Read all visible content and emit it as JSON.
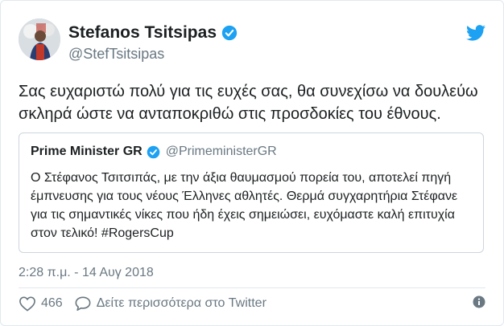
{
  "author": {
    "name": "Stefanos Tsitsipas",
    "handle": "@StefTsitsipas"
  },
  "tweet": {
    "text": "Σας ευχαριστώ πολύ για τις ευχές σας, θα συνεχίσω να δουλεύω σκληρά ώστε να ανταποκριθώ στις προσδοκίες του έθνους."
  },
  "quoted": {
    "name": "Prime Minister GR",
    "handle": "@PrimeministerGR",
    "text": "Ο Στέφανος Τσιτσιπάς, με την άξια θαυμασμού πορεία του, αποτελεί πηγή έμπνευσης για τους νέους Έλληνες αθλητές. Θερμά συγχαρητήρια Στέφανε για τις σημαντικές νίκες που ήδη έχεις σημειώσει, ευχόμαστε καλή επιτυχία στον τελικό! #RogersCup"
  },
  "timestamp": "2:28 π.μ. - 14 Αυγ 2018",
  "actions": {
    "like_count": "466",
    "more_label": "Δείτε περισσότερα στο Twitter"
  },
  "icons": {
    "avatar": "avatar",
    "verified": "verified-badge-icon",
    "logo": "twitter-bird-icon",
    "like": "heart-icon",
    "reply": "speech-bubble-icon",
    "info": "info-icon"
  },
  "colors": {
    "twitter_blue": "#1da1f2",
    "muted": "#697882",
    "text": "#1c2022",
    "border": "#e1e8ed"
  }
}
